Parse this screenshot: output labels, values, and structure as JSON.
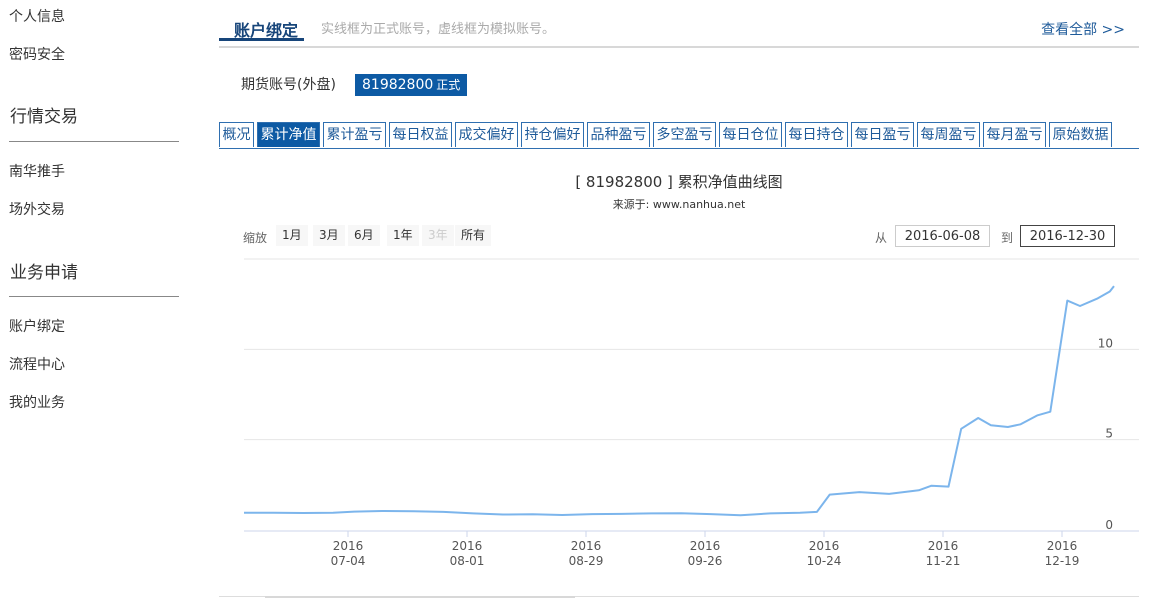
{
  "sidebar": {
    "items_top": [
      "个人信息",
      "密码安全"
    ],
    "section1": "行情交易",
    "items1": [
      "南华推手",
      "场外交易"
    ],
    "section2": "业务申请",
    "items2": [
      "账户绑定",
      "流程中心",
      "我的业务"
    ]
  },
  "header": {
    "title": "账户绑定",
    "hint": "实线框为正式账号，虚线框为模拟账号。",
    "view_all": "查看全部 >>"
  },
  "account": {
    "label": "期货账号(外盘)",
    "number": "81982800",
    "status": "正式"
  },
  "tabs": [
    {
      "label": "概况",
      "active": false
    },
    {
      "label": "累计净值",
      "active": true
    },
    {
      "label": "累计盈亏",
      "active": false
    },
    {
      "label": "每日权益",
      "active": false
    },
    {
      "label": "成交偏好",
      "active": false
    },
    {
      "label": "持仓偏好",
      "active": false
    },
    {
      "label": "品种盈亏",
      "active": false
    },
    {
      "label": "多空盈亏",
      "active": false
    },
    {
      "label": "每日仓位",
      "active": false
    },
    {
      "label": "每日持仓",
      "active": false
    },
    {
      "label": "每日盈亏",
      "active": false
    },
    {
      "label": "每周盈亏",
      "active": false
    },
    {
      "label": "每月盈亏",
      "active": false
    },
    {
      "label": "原始数据",
      "active": false
    }
  ],
  "chart": {
    "title": "[ 81982800 ] 累积净值曲线图",
    "subtitle": "来源于: www.nanhua.net",
    "zoom_label": "缩放",
    "zoom_buttons": [
      {
        "label": "1月",
        "enabled": true
      },
      {
        "label": "3月",
        "enabled": true
      },
      {
        "label": "6月",
        "enabled": true
      },
      {
        "label": "1年",
        "enabled": true
      },
      {
        "label": "3年",
        "enabled": false
      },
      {
        "label": "所有",
        "enabled": true
      }
    ],
    "from_label": "从",
    "from_date": "2016-06-08",
    "to_label": "到",
    "to_date": "2016-12-30",
    "line_color": "#7cb5ec"
  },
  "chart_data": {
    "type": "line",
    "x_ticks": [
      {
        "year": "2016",
        "md": "07-04"
      },
      {
        "year": "2016",
        "md": "08-01"
      },
      {
        "year": "2016",
        "md": "08-29"
      },
      {
        "year": "2016",
        "md": "09-26"
      },
      {
        "year": "2016",
        "md": "10-24"
      },
      {
        "year": "2016",
        "md": "11-21"
      },
      {
        "year": "2016",
        "md": "12-19"
      }
    ],
    "y_ticks": [
      "0",
      "5",
      "10"
    ],
    "ylim": [
      0,
      15
    ],
    "x": [
      "2016-06-08",
      "2016-06-15",
      "2016-06-22",
      "2016-06-29",
      "2016-07-04",
      "2016-07-11",
      "2016-07-18",
      "2016-07-25",
      "2016-08-01",
      "2016-08-08",
      "2016-08-15",
      "2016-08-22",
      "2016-08-29",
      "2016-09-05",
      "2016-09-12",
      "2016-09-19",
      "2016-09-26",
      "2016-10-03",
      "2016-10-10",
      "2016-10-17",
      "2016-10-21",
      "2016-10-24",
      "2016-10-31",
      "2016-11-07",
      "2016-11-14",
      "2016-11-17",
      "2016-11-21",
      "2016-11-24",
      "2016-11-28",
      "2016-12-01",
      "2016-12-05",
      "2016-12-08",
      "2016-12-12",
      "2016-12-15",
      "2016-12-19",
      "2016-12-22",
      "2016-12-26",
      "2016-12-29",
      "2016-12-30"
    ],
    "y": [
      0.95,
      0.96,
      0.94,
      0.95,
      1.02,
      1.05,
      1.04,
      1.0,
      0.92,
      0.86,
      0.87,
      0.83,
      0.88,
      0.89,
      0.92,
      0.93,
      0.88,
      0.82,
      0.92,
      0.96,
      1.0,
      1.96,
      2.1,
      2.0,
      2.2,
      2.45,
      2.4,
      5.6,
      6.2,
      5.8,
      5.7,
      5.85,
      6.35,
      6.55,
      12.7,
      12.4,
      12.8,
      13.2,
      13.5
    ]
  }
}
